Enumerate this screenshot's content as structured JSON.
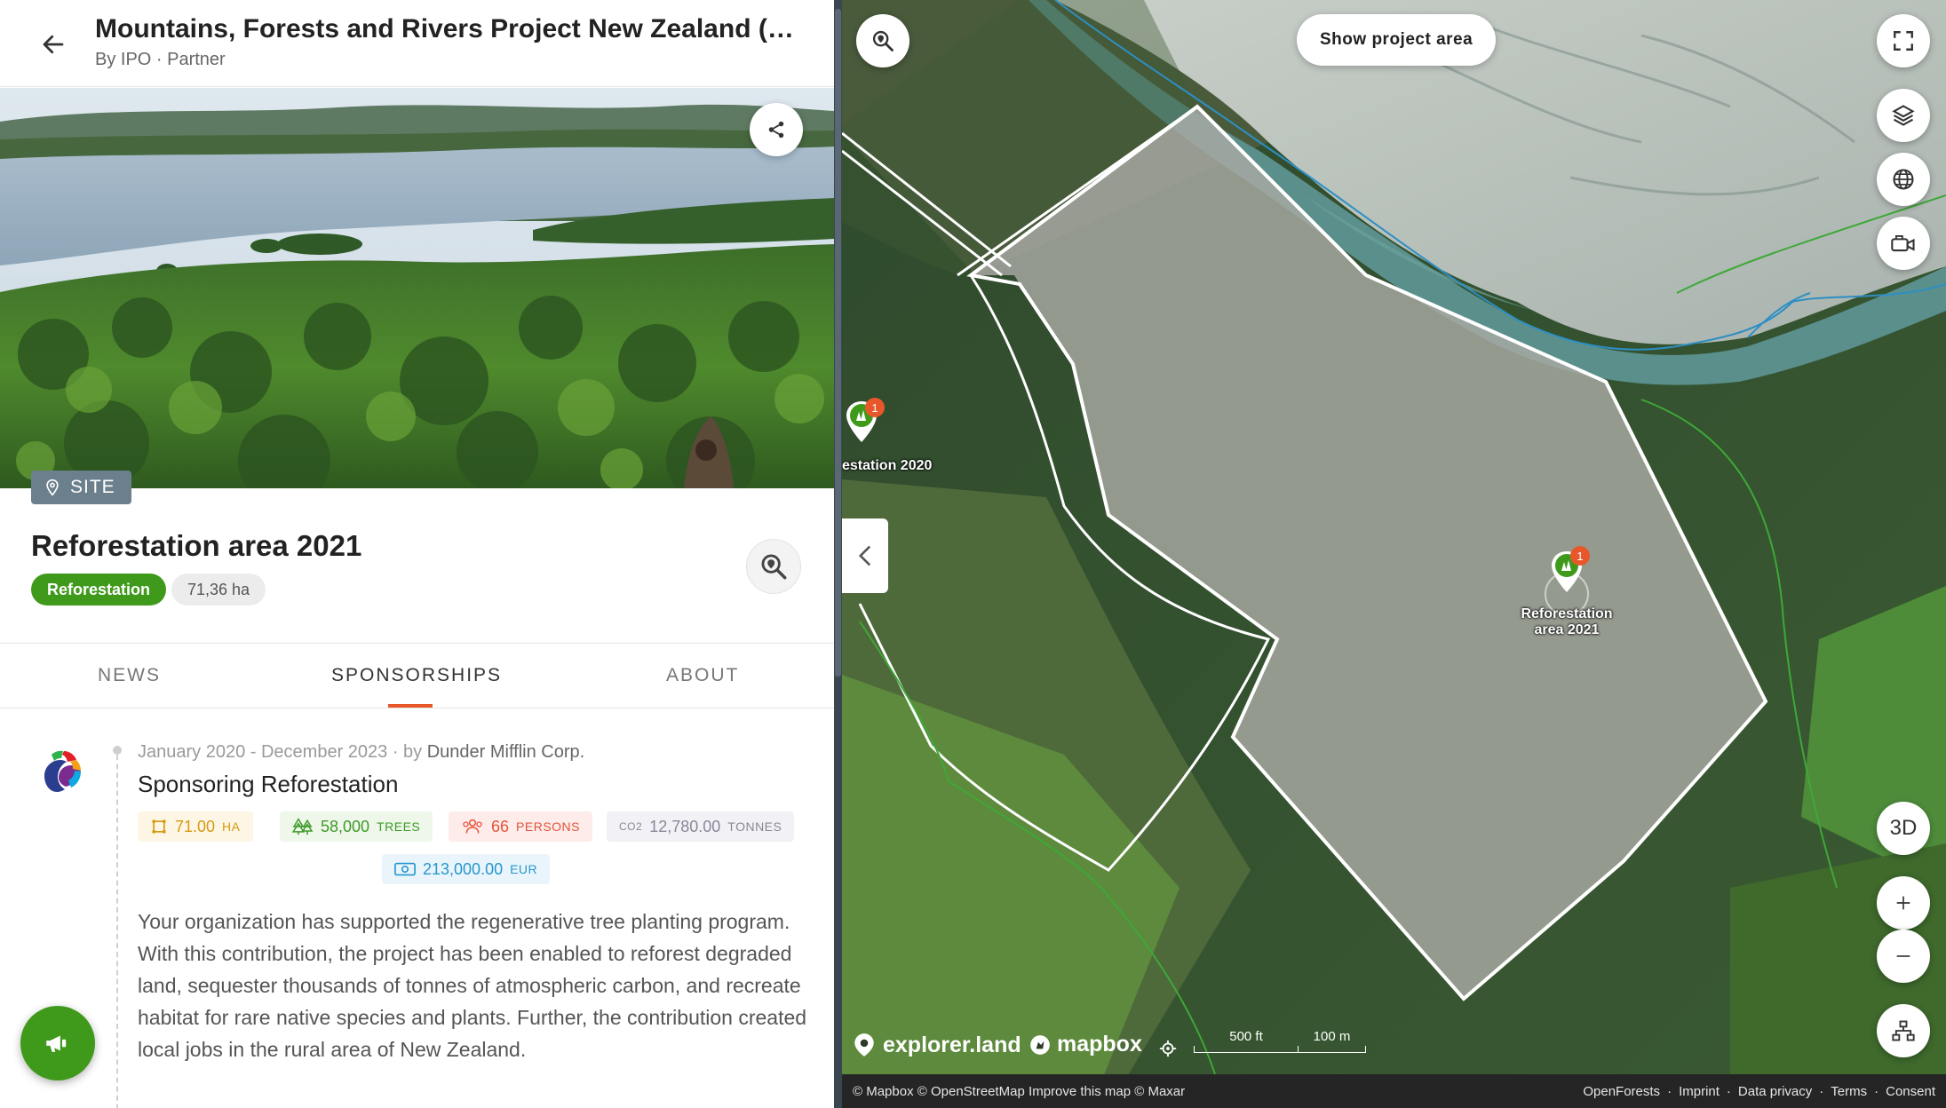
{
  "header": {
    "title": "Mountains, Forests and Rivers Project New Zealand (dem...",
    "subtitle": "By IPO · Partner"
  },
  "site": {
    "badge": "SITE",
    "title": "Reforestation area 2021",
    "category": "Reforestation",
    "area": "71,36 ha"
  },
  "tabs": [
    "NEWS",
    "SPONSORSHIPS",
    "ABOUT"
  ],
  "active_tab": "SPONSORSHIPS",
  "sponsorship": {
    "period": "January 2020 - December 2023 · by ",
    "sponsor": "Dunder Mifflin Corp.",
    "title": "Sponsoring Reforestation",
    "stats": {
      "area_value": "71.00",
      "area_unit": "HA",
      "trees_value": "58,000",
      "trees_unit": "TREES",
      "persons_value": "66",
      "persons_unit": "PERSONS",
      "co2_prefix": "CO2",
      "co2_value": "12,780.00",
      "co2_unit": "TONNES",
      "eur_value": "213,000.00",
      "eur_unit": "EUR"
    },
    "text": "Your organization has supported the regenerative tree planting program. With this contribution, the project has been enabled to reforest degraded land, sequester thousands of tonnes of atmospheric carbon, and recreate habitat for rare native species and plants. Further, the contribution created local jobs in the rural area of New Zealand."
  },
  "map": {
    "show_area_label": "Show project area",
    "three_d_label": "3D",
    "marker_left_label": "estation 2020",
    "marker_left_count": "1",
    "marker_right_label_1": "Reforestation",
    "marker_right_label_2": "area 2021",
    "marker_right_count": "1",
    "logo_explorer": "explorer.land",
    "logo_mapbox": "mapbox",
    "scale_ft": "500 ft",
    "scale_m": "100 m",
    "attribution_left": "© Mapbox © OpenStreetMap Improve this map © Maxar",
    "attribution_links": [
      "OpenForests",
      "·",
      "Imprint",
      "·",
      "Data privacy",
      "·",
      "Terms",
      "·",
      "Consent"
    ]
  },
  "colors": {
    "accent": "#e8572a",
    "green": "#3f9a1c",
    "site_badge": "#6c7f8c",
    "marker_count": "#e8572a"
  }
}
